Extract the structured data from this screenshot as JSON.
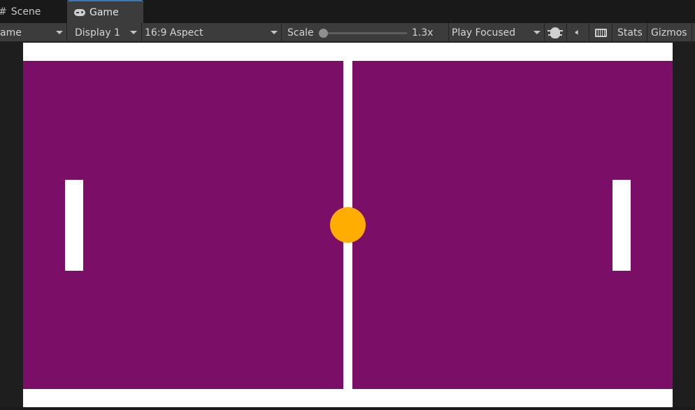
{
  "tabs": [
    {
      "label": "Scene",
      "icon": "hash-icon"
    },
    {
      "label": "Game",
      "icon": "gamepad-icon",
      "active": true
    }
  ],
  "toolbar": {
    "mode_label": "ame",
    "display_label": "Display 1",
    "aspect_label": "16:9 Aspect",
    "scale_label": "Scale",
    "scale_value": "1.3x",
    "play_mode_label": "Play Focused",
    "stats_label": "Stats",
    "gizmos_label": "Gizmos",
    "icons": [
      "bug-icon",
      "speaker-icon",
      "keyboard-icon"
    ]
  },
  "game": {
    "court_color": "#7b0e66",
    "line_color": "#ffffff",
    "ball_color": "#ffad00",
    "objects": [
      "left-paddle",
      "right-paddle",
      "ball",
      "center-net"
    ]
  }
}
